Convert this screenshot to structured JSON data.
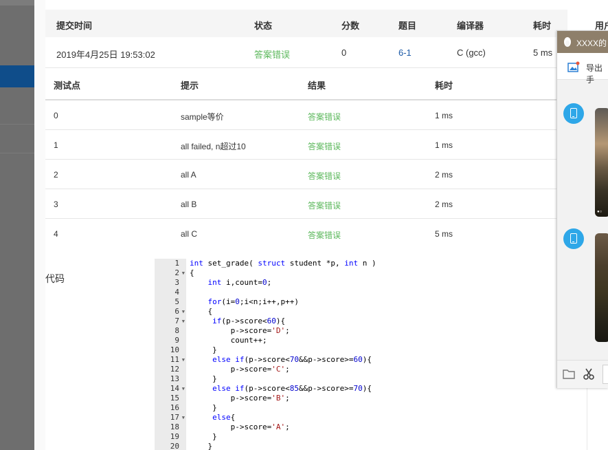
{
  "submission_table": {
    "headers": [
      "提交时间",
      "状态",
      "分数",
      "题目",
      "编译器",
      "耗时",
      "用户"
    ],
    "row": {
      "time": "2019年4月25日 19:53:02",
      "status": "答案错误",
      "score": "0",
      "problem": "6-1",
      "compiler": "C (gcc)",
      "duration": "5 ms"
    }
  },
  "testpoints": {
    "headers": [
      "测试点",
      "提示",
      "结果",
      "耗时"
    ],
    "rows": [
      {
        "id": "0",
        "hint": "sample等价",
        "result": "答案错误",
        "time": "1 ms"
      },
      {
        "id": "1",
        "hint": "all failed, n超过10",
        "result": "答案错误",
        "time": "1 ms"
      },
      {
        "id": "2",
        "hint": "all A",
        "result": "答案错误",
        "time": "2 ms"
      },
      {
        "id": "3",
        "hint": "all B",
        "result": "答案错误",
        "time": "2 ms"
      },
      {
        "id": "4",
        "hint": "all C",
        "result": "答案错误",
        "time": "5 ms"
      }
    ]
  },
  "code_section": {
    "label": "代码",
    "lines": [
      "int set_grade( struct student *p, int n )",
      "{",
      "    int i,count=0;",
      "",
      "    for(i=0;i<n;i++,p++)",
      "    {",
      "     if(p->score<60){",
      "         p->score='D';",
      "         count++;",
      "     }",
      "     else if(p->score<70&&p->score>=60){",
      "         p->score='C';",
      "     }",
      "     else if(p->score<85&&p->score>=70){",
      "         p->score='B';",
      "     }",
      "     else{",
      "         p->score='A';",
      "     }",
      "    }"
    ],
    "fold_lines": [
      2,
      6,
      7,
      11,
      14,
      17
    ]
  },
  "chat_window": {
    "title": "XXXX的",
    "toolbar_label": "导出手",
    "icons": [
      "qq-penguin-icon",
      "export-icon",
      "phone-avatar-icon",
      "folder-icon",
      "scissor-icon"
    ],
    "accent": "#8e7f6a",
    "avatar_color": "#2ea7e8"
  },
  "colors": {
    "status_wrong": "#5cb85c",
    "link": "#1c5aa7",
    "sidebar": "#6e6e6e",
    "sidebar_active": "#0f4d8a"
  }
}
